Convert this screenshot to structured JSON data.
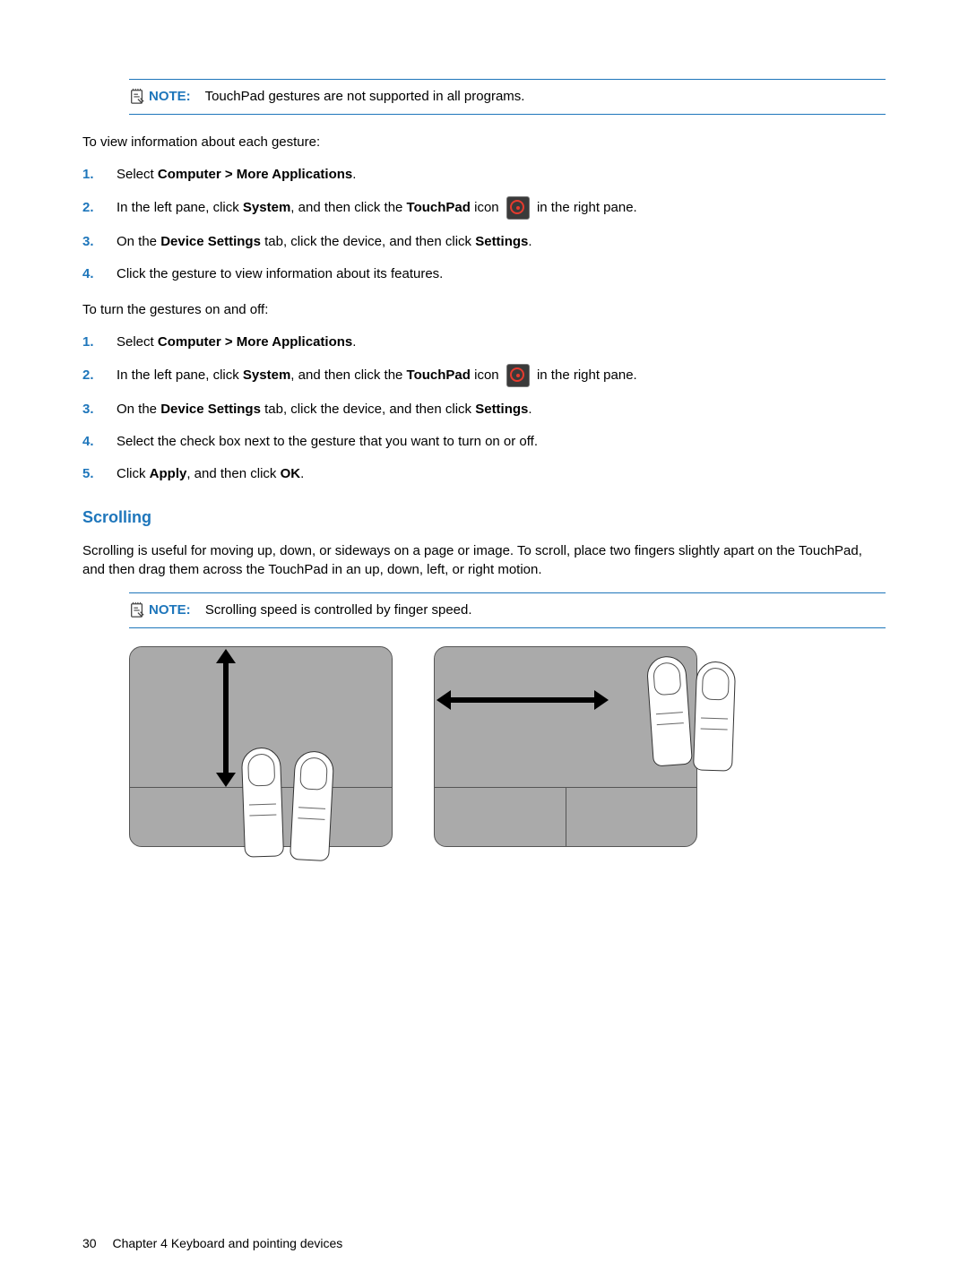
{
  "notes": {
    "topLabel": "NOTE:",
    "topText": "TouchPad gestures are not supported in all programs.",
    "scrollLabel": "NOTE:",
    "scrollText": "Scrolling speed is controlled by finger speed."
  },
  "paras": {
    "intro1": "To view information about each gesture:",
    "intro2": "To turn the gestures on and off:",
    "scrollDesc": "Scrolling is useful for moving up, down, or sideways on a page or image. To scroll, place two fingers slightly apart on the TouchPad, and then drag them across the TouchPad in an up, down, left, or right motion."
  },
  "stepsA": {
    "n1": "1.",
    "n2": "2.",
    "n3": "3.",
    "n4": "4.",
    "s1_pre": "Select ",
    "s1_bold": "Computer > More Applications",
    "s1_post": ".",
    "s2_pre": "In the left pane, click ",
    "s2_b1": "System",
    "s2_mid": ", and then click the ",
    "s2_b2": "TouchPad",
    "s2_mid2": " icon ",
    "s2_post": " in the right pane.",
    "s3_pre": "On the ",
    "s3_b1": "Device Settings",
    "s3_mid": " tab, click the device, and then click ",
    "s3_b2": "Settings",
    "s3_post": ".",
    "s4": "Click the gesture to view information about its features."
  },
  "stepsB": {
    "n1": "1.",
    "n2": "2.",
    "n3": "3.",
    "n4": "4.",
    "n5": "5.",
    "s1_pre": "Select ",
    "s1_bold": "Computer > More Applications",
    "s1_post": ".",
    "s2_pre": "In the left pane, click ",
    "s2_b1": "System",
    "s2_mid": ", and then click the ",
    "s2_b2": "TouchPad",
    "s2_mid2": " icon ",
    "s2_post": " in the right pane.",
    "s3_pre": "On the ",
    "s3_b1": "Device Settings",
    "s3_mid": " tab, click the device, and then click ",
    "s3_b2": "Settings",
    "s3_post": ".",
    "s4": "Select the check box next to the gesture that you want to turn on or off.",
    "s5_pre": "Click ",
    "s5_b1": "Apply",
    "s5_mid": ", and then click ",
    "s5_b2": "OK",
    "s5_post": "."
  },
  "headings": {
    "scrolling": "Scrolling"
  },
  "footer": {
    "pageNum": "30",
    "chapter": "Chapter 4   Keyboard and pointing devices"
  }
}
